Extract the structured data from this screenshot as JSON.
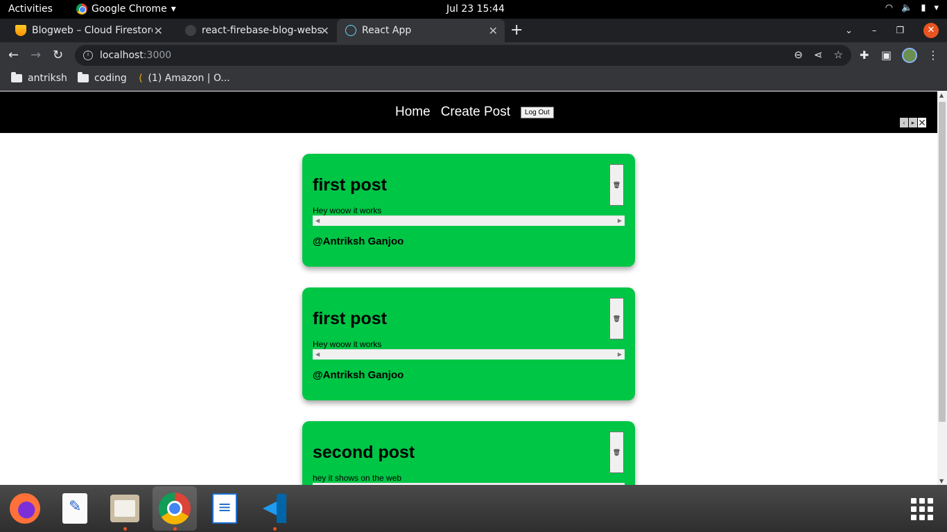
{
  "topbar": {
    "activities": "Activities",
    "app_name": "Google Chrome",
    "clock": "Jul 23  15:44"
  },
  "tabs": [
    {
      "title": "Blogweb – Cloud Firestore",
      "active": false
    },
    {
      "title": "react-firebase-blog-website",
      "active": false
    },
    {
      "title": "React App",
      "active": true
    }
  ],
  "toolbar": {
    "url_host": "localhost",
    "url_rest": ":3000"
  },
  "bookmarks": [
    {
      "label": "antriksh",
      "icon": "folder-icon"
    },
    {
      "label": "coding",
      "icon": "folder-icon"
    },
    {
      "label": "(1) Amazon | O...",
      "icon": "amazon-icon"
    }
  ],
  "page": {
    "nav": {
      "home": "Home",
      "create_post": "Create Post",
      "logout": "Log Out"
    },
    "posts": [
      {
        "title": "first post",
        "text": "Hey woow it works",
        "author": "@Antriksh Ganjoo",
        "delete": "🗑"
      },
      {
        "title": "first post",
        "text": "Hey woow it works",
        "author": "@Antriksh Ganjoo",
        "delete": "🗑"
      },
      {
        "title": "second post",
        "text": "hey it shows on the web",
        "author": "",
        "delete": "🗑"
      }
    ]
  },
  "colors": {
    "post_bg": "#00c646",
    "navbar_bg": "#000000",
    "chrome_frame": "#202124",
    "accent": "#e95420"
  },
  "dock": [
    {
      "name": "firefox",
      "running": false
    },
    {
      "name": "text-editor",
      "running": false
    },
    {
      "name": "files",
      "running": true
    },
    {
      "name": "google-chrome",
      "running": true
    },
    {
      "name": "libreoffice-writer",
      "running": false
    },
    {
      "name": "vscode",
      "running": true
    }
  ]
}
